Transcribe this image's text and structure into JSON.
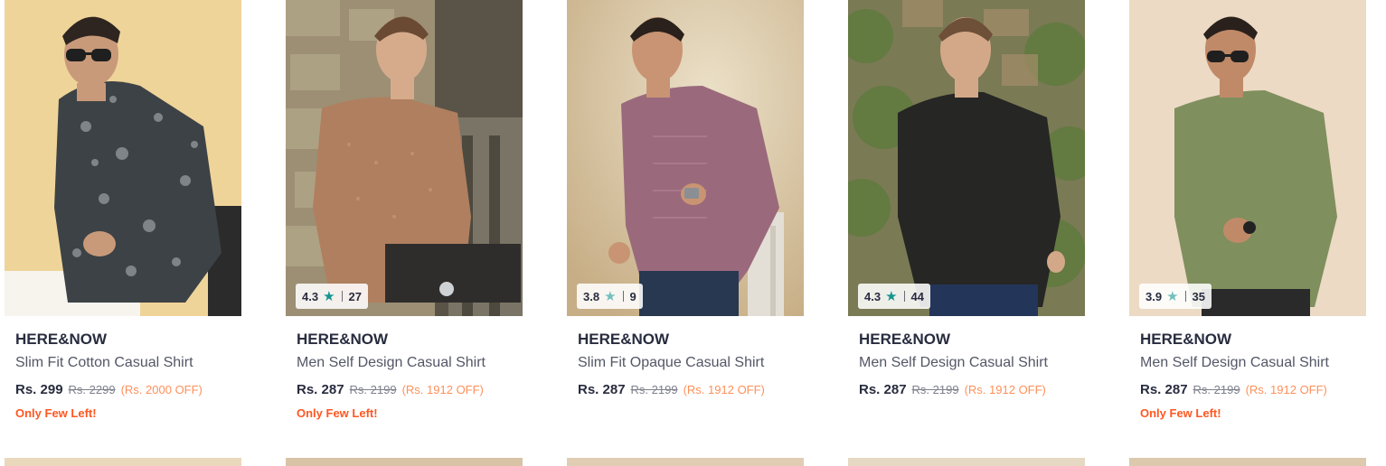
{
  "products": [
    {
      "brand": "HERE&NOW",
      "title": "Slim Fit Cotton Casual Shirt",
      "price": "Rs. 299",
      "mrp": "Rs. 2299",
      "discount": "(Rs. 2000 OFF)",
      "stock_note": "Only Few Left!",
      "rating": null,
      "rating_count": null,
      "image": "man in dark floral print shirt and sunglasses"
    },
    {
      "brand": "HERE&NOW",
      "title": "Men Self Design Casual Shirt",
      "price": "Rs. 287",
      "mrp": "Rs. 2199",
      "discount": "(Rs. 1912 OFF)",
      "stock_note": "Only Few Left!",
      "rating": "4.3",
      "rating_count": "27",
      "image": "man in light brown short sleeve shirt"
    },
    {
      "brand": "HERE&NOW",
      "title": "Slim Fit Opaque Casual Shirt",
      "price": "Rs. 287",
      "mrp": "Rs. 2199",
      "discount": "(Rs. 1912 OFF)",
      "stock_note": "",
      "rating": "3.8",
      "rating_count": "9",
      "image": "man in mauve short sleeve shirt"
    },
    {
      "brand": "HERE&NOW",
      "title": "Men Self Design Casual Shirt",
      "price": "Rs. 287",
      "mrp": "Rs. 2199",
      "discount": "(Rs. 1912 OFF)",
      "stock_note": "",
      "rating": "4.3",
      "rating_count": "44",
      "image": "man in black short sleeve shirt"
    },
    {
      "brand": "HERE&NOW",
      "title": "Men Self Design Casual Shirt",
      "price": "Rs. 287",
      "mrp": "Rs. 2199",
      "discount": "(Rs. 1912 OFF)",
      "stock_note": "Only Few Left!",
      "rating": "3.9",
      "rating_count": "35",
      "image": "man in olive green short sleeve shirt and sunglasses"
    }
  ],
  "colors": {
    "brand_text": "#282c3f",
    "title_text": "#535766",
    "mrp_text": "#7e818c",
    "discount_text": "#ff905a",
    "stock_text": "#ff5722",
    "star": "#14958f"
  }
}
